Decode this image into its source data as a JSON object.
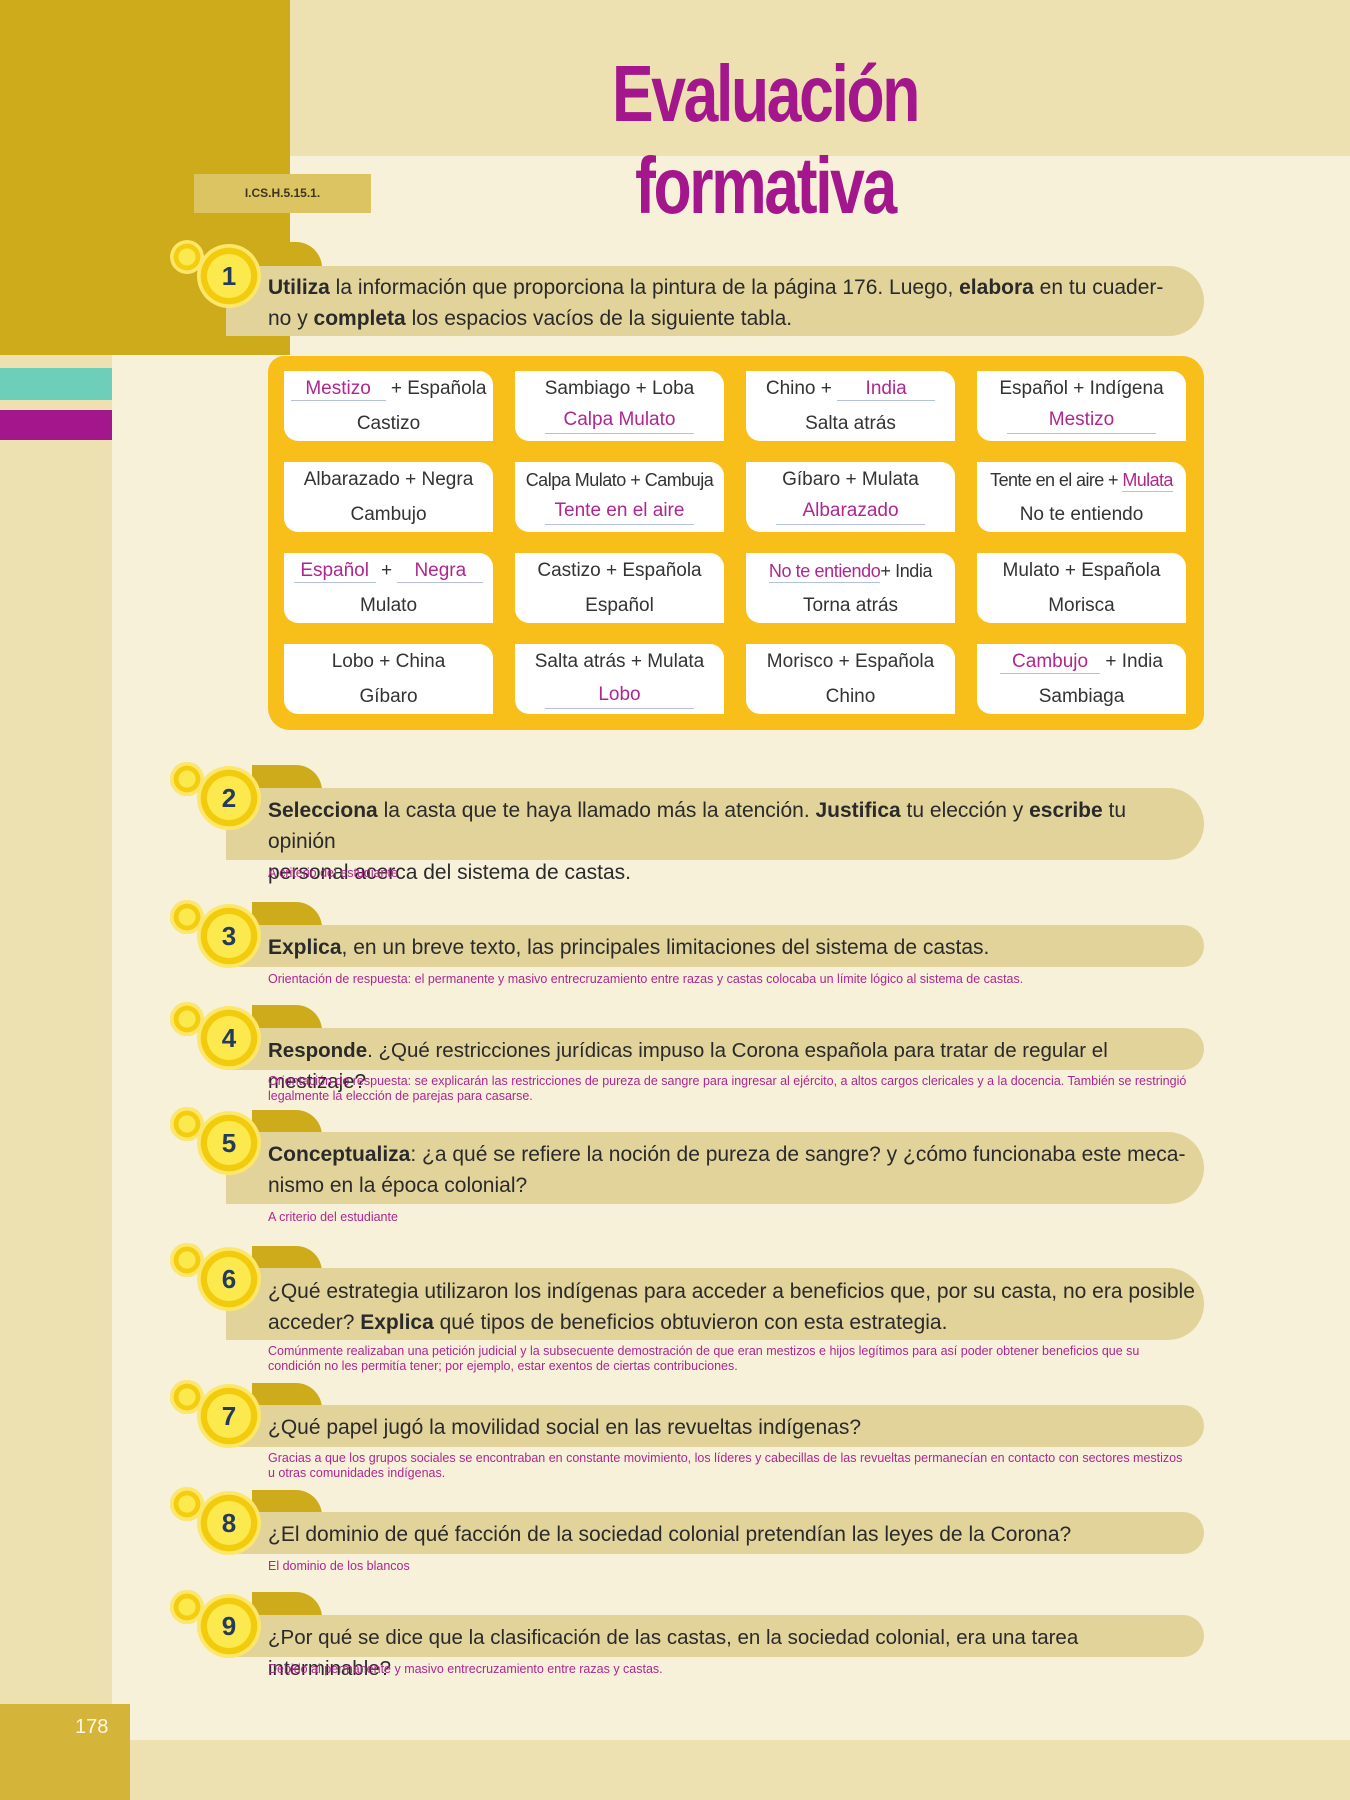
{
  "header": {
    "title": "Evaluación formativa",
    "code": "I.CS.H.5.15.1."
  },
  "footer": {
    "page_number": "178"
  },
  "questions": {
    "q1": {
      "number": "1",
      "b1": "Utiliza",
      "t1": " la información que proporciona la pintura de la página 176. Luego, ",
      "b2": "elabora",
      "t2": " en tu cuader-",
      "t3": "no y ",
      "b3": "completa",
      "t4": " los espacios vacíos de la siguiente tabla."
    },
    "q2": {
      "number": "2",
      "b1": "Selecciona",
      "t1": " la casta que te haya llamado más la atención. ",
      "b2": "Justifica",
      "t2": " tu elección y ",
      "b3": "escribe",
      "t3": " tu opinión",
      "t4": "personal acerca del sistema de castas.",
      "answer": "A criterio del estudiante"
    },
    "q3": {
      "number": "3",
      "b1": "Explica",
      "t1": ", en un breve texto, las principales limitaciones del sistema de castas.",
      "answer": "Orientación de respuesta: el permanente y masivo entrecruzamiento entre razas y castas colocaba un límite lógico al sistema de castas."
    },
    "q4": {
      "number": "4",
      "b1": "Responde",
      "t1": ". ¿Qué restricciones jurídicas impuso la Corona española para tratar de regular el mestizaje?",
      "answer_l1": "Orientación de respuesta: se explicarán las restricciones de pureza de sangre para ingresar al ejército, a altos cargos clericales y a la docencia. También se restringió",
      "answer_l2": "legalmente la elección de parejas para casarse."
    },
    "q5": {
      "number": "5",
      "b1": "Conceptualiza",
      "t1": ": ¿a qué se refiere la noción de pureza de sangre? y ¿cómo funcionaba este meca-",
      "t2": "nismo en la época colonial?",
      "answer": "A criterio del estudiante"
    },
    "q6": {
      "number": "6",
      "t1": "¿Qué estrategia utilizaron los indígenas para acceder a beneficios que, por su casta, no era posible",
      "t2": "acceder? ",
      "b1": "Explica",
      "t3": " qué tipos de beneficios obtuvieron con esta estrategia.",
      "answer_l1": "Comúnmente realizaban una petición judicial y la subsecuente demostración de que eran mestizos e hijos legítimos para así poder obtener beneficios que su",
      "answer_l2": "condición no les permitía tener; por ejemplo, estar exentos de ciertas contribuciones."
    },
    "q7": {
      "number": "7",
      "t1": "¿Qué papel jugó la movilidad social en las revueltas indígenas?",
      "answer_l1": "Gracias a que los grupos sociales se encontraban en constante movimiento, los líderes y cabecillas de las revueltas permanecían en contacto con sectores mestizos",
      "answer_l2": "u otras comunidades indígenas."
    },
    "q8": {
      "number": "8",
      "t1": "¿El dominio de qué facción de la sociedad colonial pretendían las leyes de la Corona?",
      "answer": "El dominio de los blancos"
    },
    "q9": {
      "number": "9",
      "t1": "¿Por qué se dice que la clasificación de las castas, en la sociedad colonial, era una tarea interminable?",
      "answer": "Debido al permanente y masivo entrecruzamiento entre razas y castas."
    }
  },
  "table": {
    "r1c1": {
      "a": "Mestizo",
      "b": "+ Española",
      "c": "Castizo"
    },
    "r1c2": {
      "a": "Sambiago + Loba",
      "c": "Calpa Mulato"
    },
    "r1c3": {
      "a": "Chino +",
      "b": "India",
      "c": "Salta atrás"
    },
    "r1c4": {
      "a": "Español + Indígena",
      "c": "Mestizo"
    },
    "r2c1": {
      "a": "Albarazado + Negra",
      "c": "Cambujo"
    },
    "r2c2": {
      "a": "Calpa Mulato + Cambuja",
      "c": "Tente en el aire"
    },
    "r2c3": {
      "a": "Gíbaro + Mulata",
      "c": "Albarazado"
    },
    "r2c4": {
      "a": "Tente en el aire +",
      "b": "Mulata",
      "c": "No te entiendo"
    },
    "r3c1": {
      "a": "Español",
      "plus": "+",
      "b": "Negra",
      "c": "Mulato"
    },
    "r3c2": {
      "a": "Castizo + Española",
      "c": "Español"
    },
    "r3c3": {
      "a": "No te entiendo",
      "b": "+ India",
      "c": "Torna atrás"
    },
    "r3c4": {
      "a": "Mulato + Española",
      "c": "Morisca"
    },
    "r4c1": {
      "a": "Lobo + China",
      "c": "Gíbaro"
    },
    "r4c2": {
      "a": "Salta atrás + Mulata",
      "c": "Lobo"
    },
    "r4c3": {
      "a": "Morisco + Española",
      "c": "Chino"
    },
    "r4c4": {
      "a": "Cambujo",
      "b": "+ India",
      "c": "Sambiaga"
    }
  },
  "colors": {
    "gold": "#cdab1b",
    "cream": "#ede1b2",
    "band": "#e2d39a",
    "table_orange": "#f8be19",
    "magenta": "#a3168c",
    "teal": "#6dcfb9"
  }
}
